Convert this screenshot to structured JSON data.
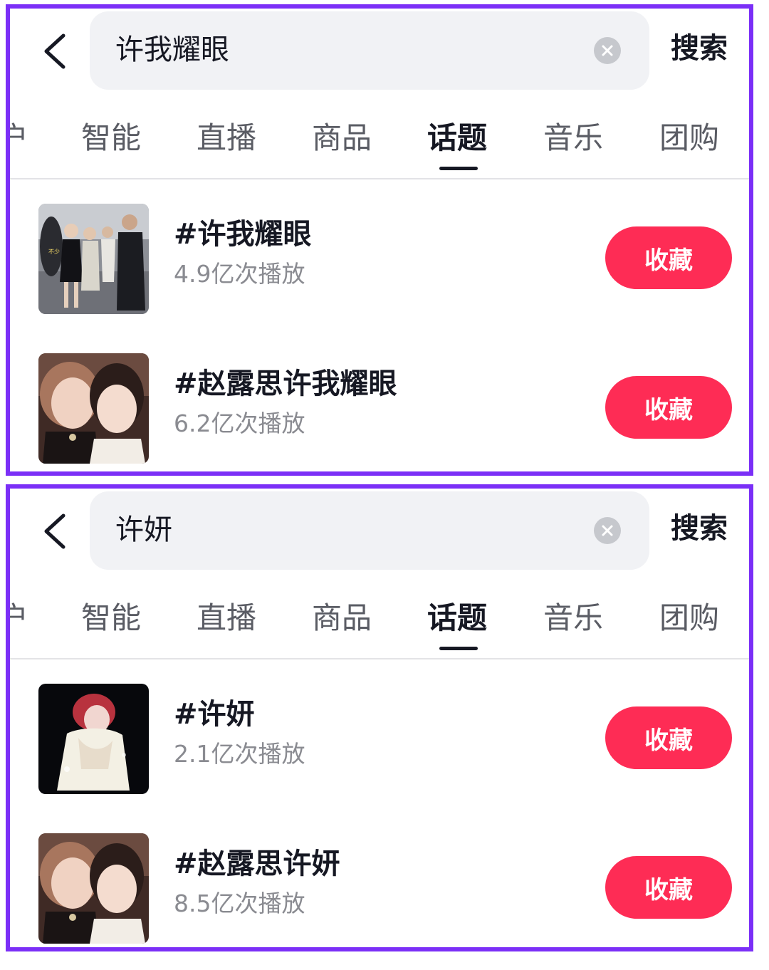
{
  "panels": [
    {
      "query": "许我耀眼",
      "search_label": "搜索",
      "tabs": [
        "户",
        "智能",
        "直播",
        "商品",
        "话题",
        "音乐",
        "团购"
      ],
      "active_tab": "话题",
      "topics": [
        {
          "title": "#许我耀眼",
          "plays": "4.9亿次播放",
          "action": "收藏"
        },
        {
          "title": "#赵露思许我耀眼",
          "plays": "6.2亿次播放",
          "action": "收藏"
        }
      ]
    },
    {
      "query": "许妍",
      "search_label": "搜索",
      "tabs": [
        "户",
        "智能",
        "直播",
        "商品",
        "话题",
        "音乐",
        "团购"
      ],
      "active_tab": "话题",
      "topics": [
        {
          "title": "#许妍",
          "plays": "2.1亿次播放",
          "action": "收藏"
        },
        {
          "title": "#赵露思许妍",
          "plays": "8.5亿次播放",
          "action": "收藏"
        }
      ]
    }
  ],
  "colors": {
    "frame": "#7b2ff7",
    "accent": "#fe2c55",
    "search_bg": "#f1f2f5",
    "text_primary": "#161823",
    "text_secondary": "#8a8b91"
  },
  "icons": [
    "back-arrow-icon",
    "clear-icon"
  ]
}
